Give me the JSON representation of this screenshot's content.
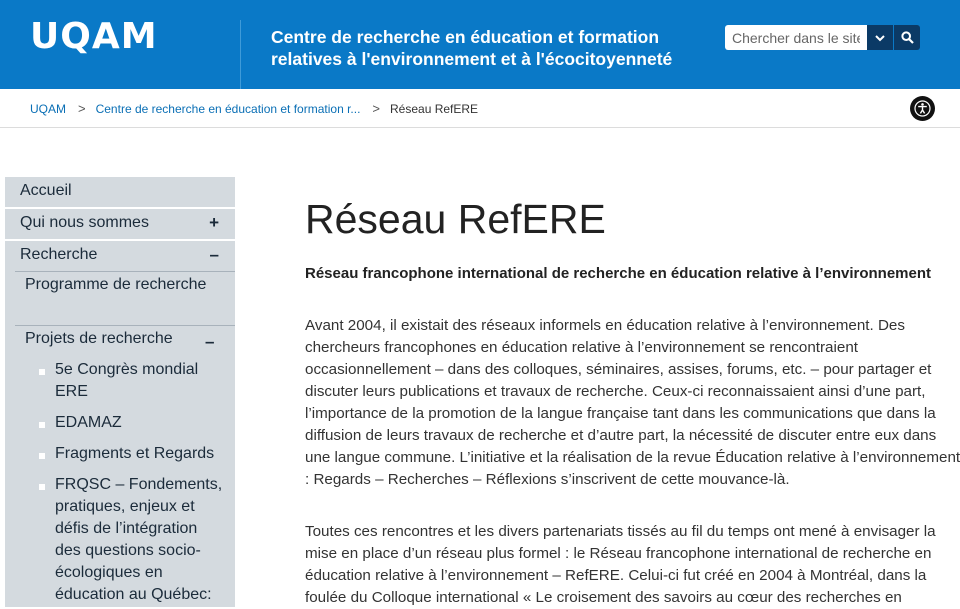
{
  "header": {
    "logo": "UQAM",
    "site_title": "Centre de recherche en éducation et formation relatives à l'environnement et à l'écocitoyenneté",
    "search_placeholder": "Chercher dans le site"
  },
  "breadcrumb": [
    {
      "label": "UQAM"
    },
    {
      "label": "Centre de recherche en éducation et formation r..."
    },
    {
      "label": "Réseau RefERE"
    }
  ],
  "sidebar": {
    "level1": [
      {
        "label": "Accueil"
      },
      {
        "label": "Qui nous sommes",
        "toggle": "+"
      },
      {
        "label": "Recherche",
        "toggle": "–"
      }
    ],
    "level2": [
      {
        "label": "Programme de recherche"
      },
      {
        "label": "Projets de recherche",
        "toggle": "–"
      }
    ],
    "level3": [
      {
        "label": "5e Congrès mondial ERE"
      },
      {
        "label": "EDAMAZ"
      },
      {
        "label": "Fragments et Regards"
      },
      {
        "label": "FRQSC – Fondements, pratiques, enjeux et défis de l’intégration des questions socio-écologiques en éducation au Québec:"
      }
    ]
  },
  "main": {
    "title": "Réseau RefERE",
    "lead": "Réseau francophone international de recherche en éducation relative à l’environnement",
    "paragraphs": [
      "Avant 2004, il existait des réseaux informels en éducation relative à l’environnement. Des chercheurs francophones en éducation relative à l’environnement se rencontraient occasionnellement – dans des colloques, séminaires, assises, forums, etc. – pour partager et discuter leurs publications et travaux de recherche. Ceux-ci reconnaissaient ainsi d’une part, l’importance de la promotion de la langue française tant dans les communications que dans la diffusion de leurs travaux de recherche et d’autre part, la nécessité de discuter entre eux dans une langue commune. L’initiative et la réalisation de la revue Éducation relative à l’environnement : Regards – Recherches – Réflexions s’inscrivent de cette mouvance-là.",
      "Toutes ces rencontres et les divers partenariats tissés au fil du temps ont mené à envisager la mise en place d’un réseau plus formel : le Réseau francophone international de recherche en éducation relative à l’environnement – RefERE. Celui-ci fut créé en 2004 à Montréal, dans la foulée du Colloque international « Le croisement des savoirs au cœur des recherches en"
    ]
  },
  "icons": {
    "dropdown": "chevron-down-icon",
    "search": "search-icon",
    "accessibility": "accessibility-icon"
  },
  "colors": {
    "header_bg": "#0a79c7",
    "sidebar_bg": "#d4dadf",
    "search_button": "#0b3a66",
    "link": "#0a6fb5"
  }
}
